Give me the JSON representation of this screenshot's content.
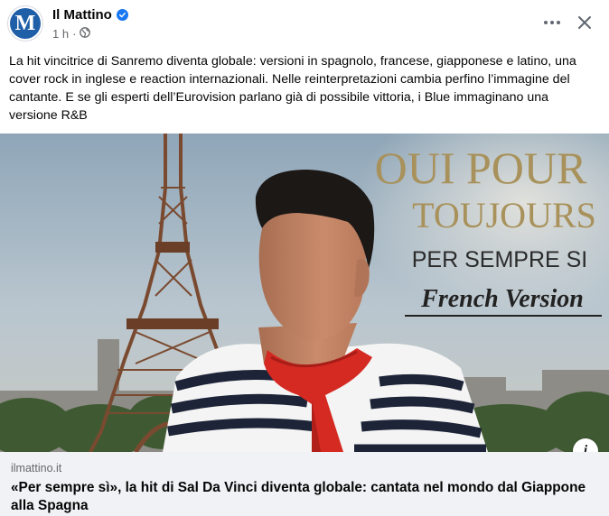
{
  "post": {
    "page_name": "Il Mattino",
    "avatar_letter": "M",
    "time": "1 h",
    "dot_separator": "·",
    "text": "La hit vincitrice di Sanremo diventa globale: versioni in spagnolo, francese, giapponese e latino, una cover rock in inglese e reaction internazionali. Nelle reinterpretazioni cambia perfino l’immagine del cantante. E se gli esperti dell’Eurovision parlano già di possibile vittoria, i Blue immaginano una versione R&B",
    "more_options_icon": "more-dots-icon",
    "close_icon": "close-icon",
    "audience_icon": "globe-icon",
    "verified_icon": "verified-badge-icon"
  },
  "image_overlay": {
    "line1": "OUI POUR",
    "line2": "TOUJOURS",
    "line3": "PER SEMPRE SI",
    "line4": "French Version"
  },
  "link": {
    "domain": "ilmattino.it",
    "title": "«Per sempre sì», la hit di Sal Da Vinci diventa globale: cantata nel mondo dal Giappone alla Spagna",
    "info_label": "i"
  },
  "colors": {
    "brand_blue": "#1f5fa8",
    "verified_blue": "#1877f2",
    "gold_text": "#a8915a",
    "dark_text": "#2b2b2b",
    "footer_bg": "#f0f2f5"
  }
}
